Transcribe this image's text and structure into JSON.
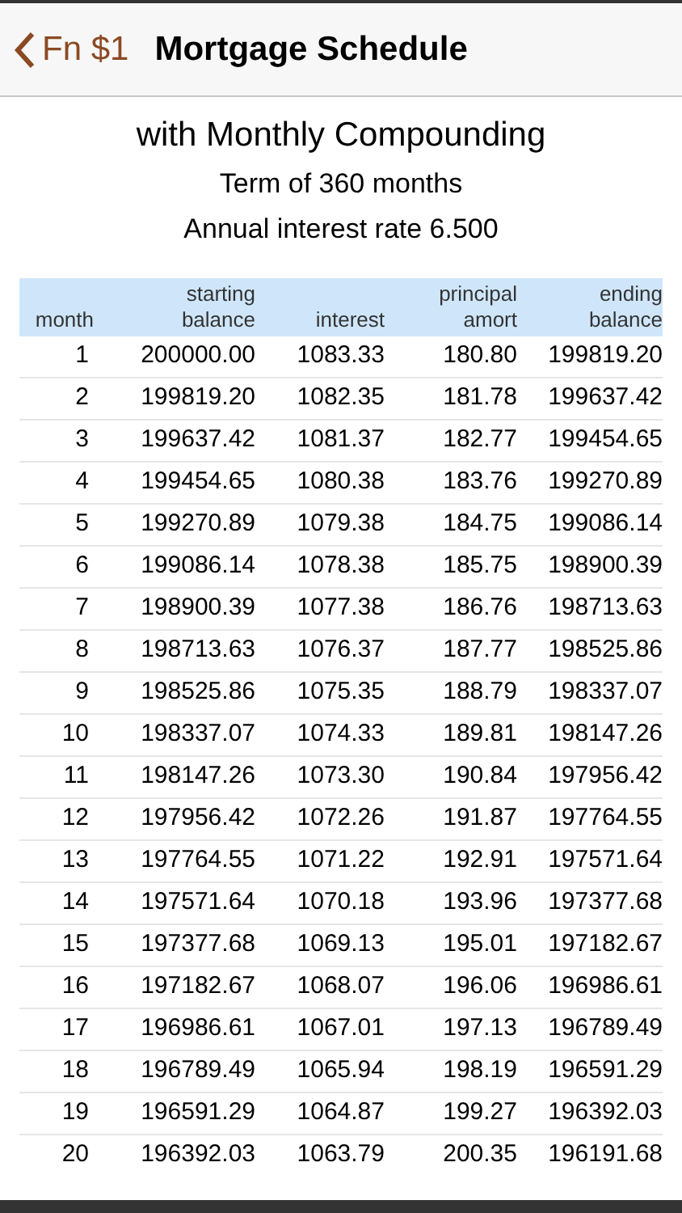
{
  "nav": {
    "back": "Fn $1",
    "title": "Mortgage Schedule"
  },
  "subtitle": "with Monthly Compounding",
  "info": [
    "Term of 360 months",
    "Annual interest rate 6.500"
  ],
  "table": {
    "columns": [
      "month",
      "starting\nbalance",
      "interest",
      "principal\namort",
      "ending\nbalance"
    ],
    "rows": [
      [
        "1",
        "200000.00",
        "1083.33",
        "180.80",
        "199819.20"
      ],
      [
        "2",
        "199819.20",
        "1082.35",
        "181.78",
        "199637.42"
      ],
      [
        "3",
        "199637.42",
        "1081.37",
        "182.77",
        "199454.65"
      ],
      [
        "4",
        "199454.65",
        "1080.38",
        "183.76",
        "199270.89"
      ],
      [
        "5",
        "199270.89",
        "1079.38",
        "184.75",
        "199086.14"
      ],
      [
        "6",
        "199086.14",
        "1078.38",
        "185.75",
        "198900.39"
      ],
      [
        "7",
        "198900.39",
        "1077.38",
        "186.76",
        "198713.63"
      ],
      [
        "8",
        "198713.63",
        "1076.37",
        "187.77",
        "198525.86"
      ],
      [
        "9",
        "198525.86",
        "1075.35",
        "188.79",
        "198337.07"
      ],
      [
        "10",
        "198337.07",
        "1074.33",
        "189.81",
        "198147.26"
      ],
      [
        "11",
        "198147.26",
        "1073.30",
        "190.84",
        "197956.42"
      ],
      [
        "12",
        "197956.42",
        "1072.26",
        "191.87",
        "197764.55"
      ],
      [
        "13",
        "197764.55",
        "1071.22",
        "192.91",
        "197571.64"
      ],
      [
        "14",
        "197571.64",
        "1070.18",
        "193.96",
        "197377.68"
      ],
      [
        "15",
        "197377.68",
        "1069.13",
        "195.01",
        "197182.67"
      ],
      [
        "16",
        "197182.67",
        "1068.07",
        "196.06",
        "196986.61"
      ],
      [
        "17",
        "196986.61",
        "1067.01",
        "197.13",
        "196789.49"
      ],
      [
        "18",
        "196789.49",
        "1065.94",
        "198.19",
        "196591.29"
      ],
      [
        "19",
        "196591.29",
        "1064.87",
        "199.27",
        "196392.03"
      ],
      [
        "20",
        "196392.03",
        "1063.79",
        "200.35",
        "196191.68"
      ]
    ]
  }
}
